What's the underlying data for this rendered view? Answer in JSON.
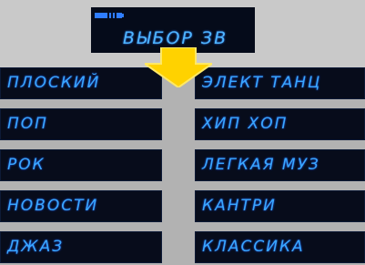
{
  "header": {
    "title": "ВЫБОР ЗВ",
    "battery_icon": "battery-icon"
  },
  "menu": {
    "left": [
      {
        "label": "ПЛОСКИЙ"
      },
      {
        "label": "ПОП"
      },
      {
        "label": "РОК"
      },
      {
        "label": "НОВОСТИ"
      },
      {
        "label": "ДЖАЗ"
      }
    ],
    "right": [
      {
        "label": "ЭЛЕКТ ТАНЦ"
      },
      {
        "label": "ХИП ХОП"
      },
      {
        "label": "ЛЕГКАЯ МУЗ"
      },
      {
        "label": "КАНТРИ"
      },
      {
        "label": "КЛАССИКА"
      }
    ]
  },
  "colors": {
    "background": "#c9c9c9",
    "panel": "#070c1b",
    "text": "#3aa8ff",
    "arrow": "#ffd200"
  }
}
